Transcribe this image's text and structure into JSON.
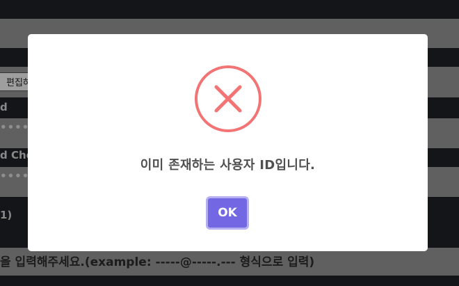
{
  "background": {
    "tooltip": "편집하려면 클릭하세요.",
    "label_1": "d",
    "password_mask_1": "•••••",
    "label_2": "d Che",
    "password_mask_2": "•••••",
    "label_3": "1)",
    "bottom_note": "을 입력해주세요.(example: -----@-----.--- 형식으로 입력)"
  },
  "modal": {
    "icon": "error-x-icon",
    "icon_color": "#f27474",
    "message": "이미 존재하는 사용자 ID입니다.",
    "ok_label": "OK",
    "ok_color": "#7367e3"
  }
}
